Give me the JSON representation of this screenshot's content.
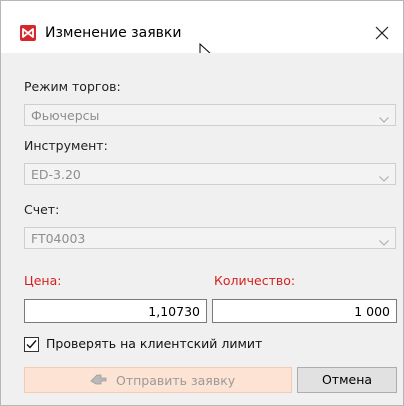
{
  "window": {
    "title": "Изменение заявки",
    "close_label": "×"
  },
  "form": {
    "trading_mode": {
      "label": "Режим торгов:",
      "value": "Фьючерсы"
    },
    "instrument": {
      "label": "Инструмент:",
      "value": "ED-3.20"
    },
    "account": {
      "label": "Счет:",
      "value": "FT04003"
    },
    "price": {
      "label": "Цена:",
      "value": "1,10730"
    },
    "quantity": {
      "label": "Количество:",
      "value": "1 000"
    },
    "client_limit_check": {
      "label": "Проверять на клиентский лимит",
      "checked": true
    }
  },
  "buttons": {
    "send": "Отправить заявку",
    "cancel": "Отмена"
  },
  "colors": {
    "brand": "#d8262b",
    "required_label": "#d62020",
    "send_button_bg": "#fde3d3"
  },
  "icons": {
    "app": "moex-logo-icon",
    "close": "close-icon",
    "dropdown": "chevron-down-icon",
    "send": "send-hand-icon",
    "checkbox": "checkmark-icon"
  }
}
